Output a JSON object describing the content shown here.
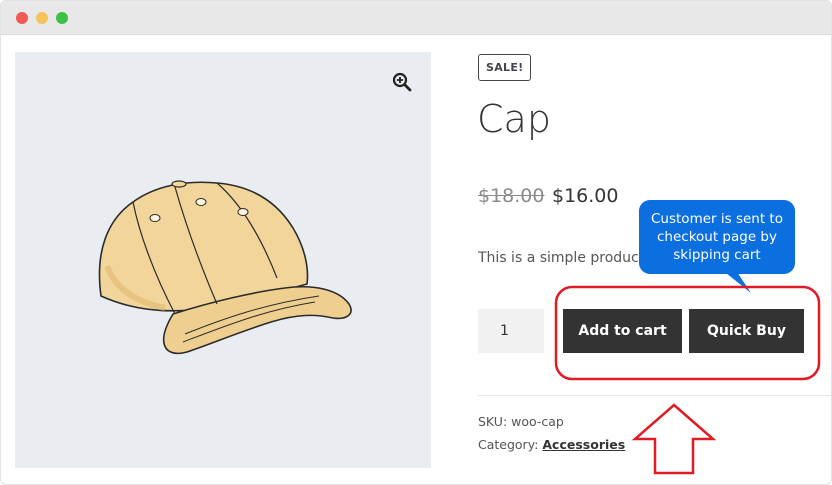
{
  "window": {
    "controls": [
      "close",
      "minimize",
      "maximize"
    ]
  },
  "product": {
    "badge": "SALE!",
    "title": "Cap",
    "old_price": "$18.00",
    "price": "$16.00",
    "description": "This is a simple product.",
    "quantity": "1",
    "add_to_cart_label": "Add to cart",
    "quick_buy_label": "Quick Buy",
    "sku_label": "SKU: ",
    "sku": "woo-cap",
    "category_label": "Category: ",
    "category": "Accessories",
    "image_icon": "baseball-cap-illustration",
    "zoom_icon": "magnify-plus-icon"
  },
  "annotation": {
    "callout_text": "Customer is sent to checkout page by skipping cart",
    "highlight_color": "#e01b24",
    "callout_color": "#0b6fe0",
    "arrow_icon": "up-arrow-outline"
  }
}
